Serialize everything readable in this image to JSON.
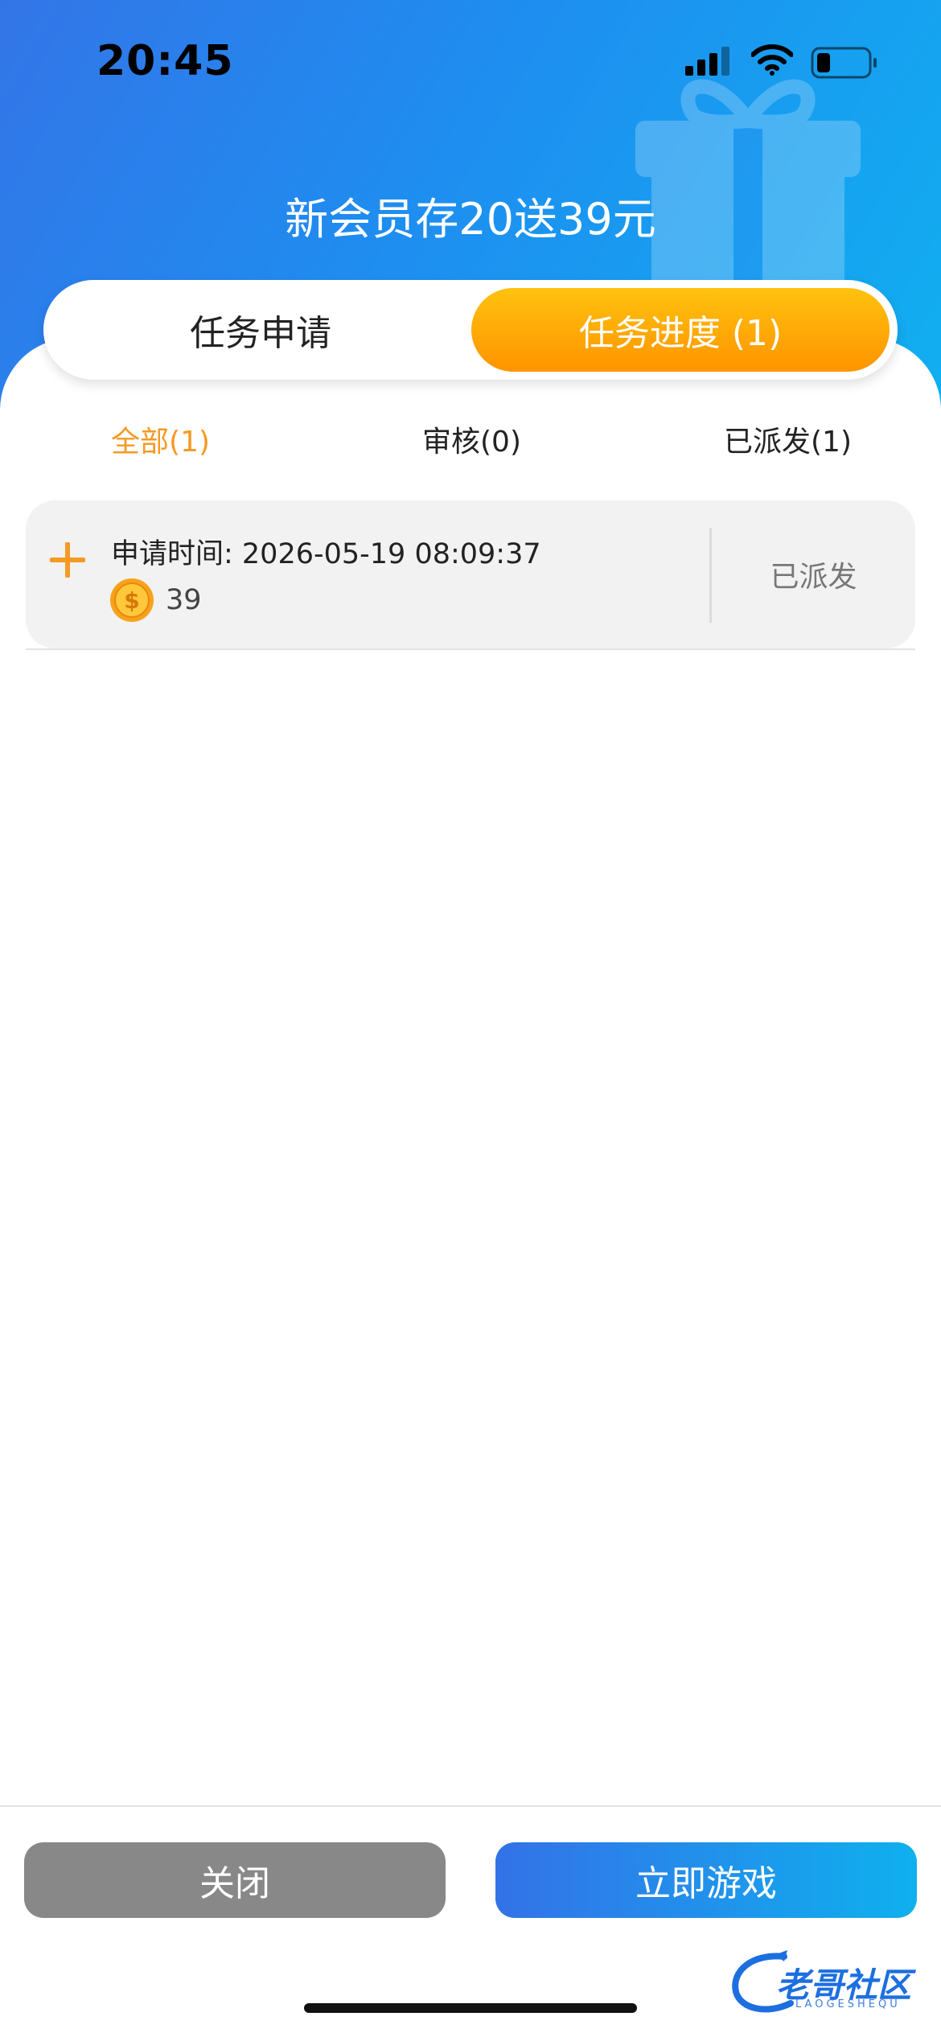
{
  "status_bar": {
    "time": "20:45"
  },
  "header": {
    "title": "新会员存20送39元"
  },
  "segment_tabs": [
    {
      "label": "任务申请",
      "selected": false
    },
    {
      "label": "任务进度 (1)",
      "selected": true
    }
  ],
  "filters": [
    {
      "label": "全部(1)",
      "active": true
    },
    {
      "label": "审核(0)",
      "active": false
    },
    {
      "label": "已派发(1)",
      "active": false
    }
  ],
  "records": [
    {
      "label": "申请时间: 2026-05-19 08:09:37",
      "amount": "39",
      "status": "已派发"
    }
  ],
  "footer": {
    "close_label": "关闭",
    "play_label": "立即游戏"
  },
  "watermark": {
    "text": "老哥社区",
    "subtext": "LAOGESHEQU"
  },
  "colors": {
    "header_start": "#3375e8",
    "header_end": "#10b0f0",
    "accent_orange": "#f59a23",
    "close_gray": "#888888"
  },
  "icons": [
    "cellular-signal-icon",
    "wifi-icon",
    "battery-icon",
    "gift-icon",
    "plus-icon",
    "coin-icon"
  ]
}
